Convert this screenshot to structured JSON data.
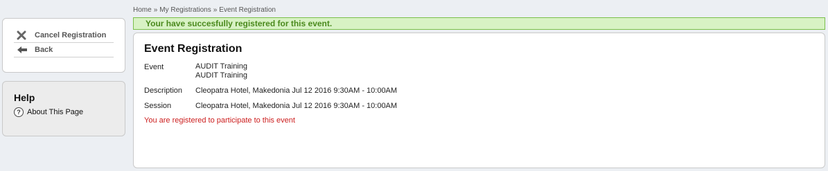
{
  "breadcrumb": {
    "items": [
      "Home",
      "My Registrations",
      "Event Registration"
    ],
    "separator": "»"
  },
  "actions": {
    "cancel_label": "Cancel Registration",
    "back_label": "Back"
  },
  "help": {
    "title": "Help",
    "about_label": "About This Page"
  },
  "banner": {
    "message": "Your have succesfully registered for this event."
  },
  "main": {
    "title": "Event Registration",
    "event_label": "Event",
    "event_values": [
      "AUDIT Training",
      "AUDIT Training"
    ],
    "description_label": "Description",
    "description_value": "Cleopatra Hotel, Makedonia Jul 12 2016 9:30AM - 10:00AM",
    "session_label": "Session",
    "session_value": "Cleopatra Hotel, Makedonia Jul 12 2016 9:30AM - 10:00AM",
    "status_message": "You are registered to participate to this event"
  },
  "colors": {
    "success_bg": "#d8f2c4",
    "success_text": "#4a8a1d",
    "error_text": "#cc1d1d"
  }
}
